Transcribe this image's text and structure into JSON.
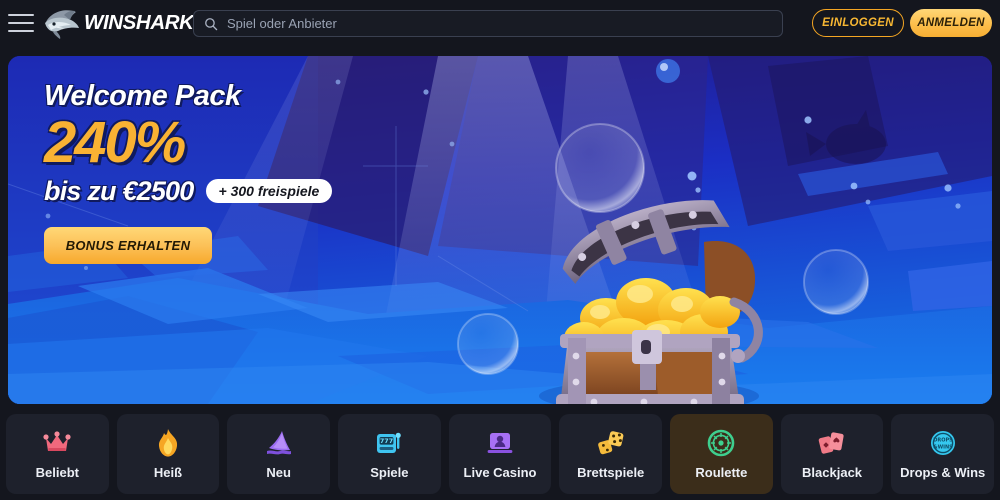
{
  "header": {
    "menu_label": "menu",
    "brand": "WINSHARK",
    "search_placeholder": "Spiel oder Anbieter",
    "login_label": "EINLOGGEN",
    "register_label": "ANMELDEN"
  },
  "banner": {
    "title": "Welcome Pack",
    "percent": "240%",
    "subtitle": "bis zu €2500",
    "badge": "+ 300 freispiele",
    "cta": "BONUS ERHALTEN",
    "theme": "underwater-treasure-chest"
  },
  "categories": [
    {
      "label": "Beliebt",
      "icon": "crown-icon",
      "color": "#f06a7e",
      "active": false
    },
    {
      "label": "Heiß",
      "icon": "flame-icon",
      "color": "#f6a623",
      "active": false
    },
    {
      "label": "Neu",
      "icon": "shark-fin-icon",
      "color": "#9a6cf0",
      "active": false
    },
    {
      "label": "Spiele",
      "icon": "slot-machine-icon",
      "color": "#3fc4f0",
      "active": false
    },
    {
      "label": "Live Casino",
      "icon": "live-dealer-icon",
      "color": "#a770f5",
      "active": false
    },
    {
      "label": "Brettspiele",
      "icon": "dice-icon",
      "color": "#f5bb3c",
      "active": false
    },
    {
      "label": "Roulette",
      "icon": "roulette-wheel-icon",
      "color": "#3ecf8e",
      "active": true
    },
    {
      "label": "Blackjack",
      "icon": "playing-cards-icon",
      "color": "#f07a87",
      "active": false
    },
    {
      "label": "Drops & Wins",
      "icon": "drops-wins-icon",
      "color": "#35c8ef",
      "active": false
    }
  ],
  "colors": {
    "page_bg": "#14161e",
    "tile_bg": "#1e212c",
    "tile_active_bg": "#3b2d1a",
    "accent_gold": "#f7b733",
    "banner_blue": "#1b2bb0"
  }
}
